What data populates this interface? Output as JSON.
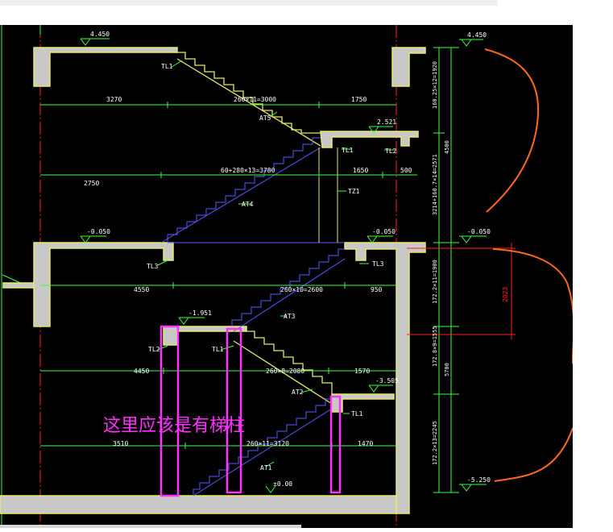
{
  "annotation": {
    "text": "这里应该是有梯柱",
    "color": "#ff33ff"
  },
  "colors": {
    "background": "#000000",
    "slab": "#c8c8c8",
    "outline": "#e8e86a",
    "dim": "#3cff3c",
    "blueline": "#5a5aff",
    "axis": "#ff2020",
    "highlight": "#ff33ff",
    "sketch": "#ff6a1a"
  },
  "levels": {
    "top": "4.450",
    "top_right": "4.450",
    "mid_landing": "2.521",
    "floor": "-0.050",
    "floor_right": "-0.050",
    "floor_far_right": "-0.050",
    "basement_landing": "-1.951",
    "lower_landing": "-3.505",
    "bottom": "-5.250",
    "bottom_mark": "±0.00"
  },
  "beams": {
    "tl1_a": "TL1",
    "tl1_b": "TL1",
    "tl2_a": "TL2",
    "tl3_a": "TL3",
    "tl3_b": "TL3",
    "tl2_b": "TL2",
    "tl1_c": "TL1",
    "tl1_d": "TL1",
    "tz1": "TZ1"
  },
  "flights": {
    "at5": "AT5",
    "at4": "AT4",
    "at3": "AT3",
    "at2": "AT2",
    "at1": "AT1"
  },
  "dims": {
    "row1": [
      "3270",
      "260×11=3000",
      "1750"
    ],
    "row2": [
      "2750",
      "60+280×13=3780",
      "1650",
      "500"
    ],
    "row3": [
      "4550",
      "260×10=2600",
      "950"
    ],
    "row4": [
      "4450",
      "260×8=2080",
      "1570"
    ],
    "row5": [
      "3510",
      "260×11=3120",
      "1470"
    ],
    "vertical": [
      "160.25×12=1920",
      "4500",
      "3214+160.7×14=2571",
      "172.2×11=1900",
      "172.8×9=1555",
      "5700",
      "172.2×13=2245"
    ],
    "red": "2023"
  }
}
